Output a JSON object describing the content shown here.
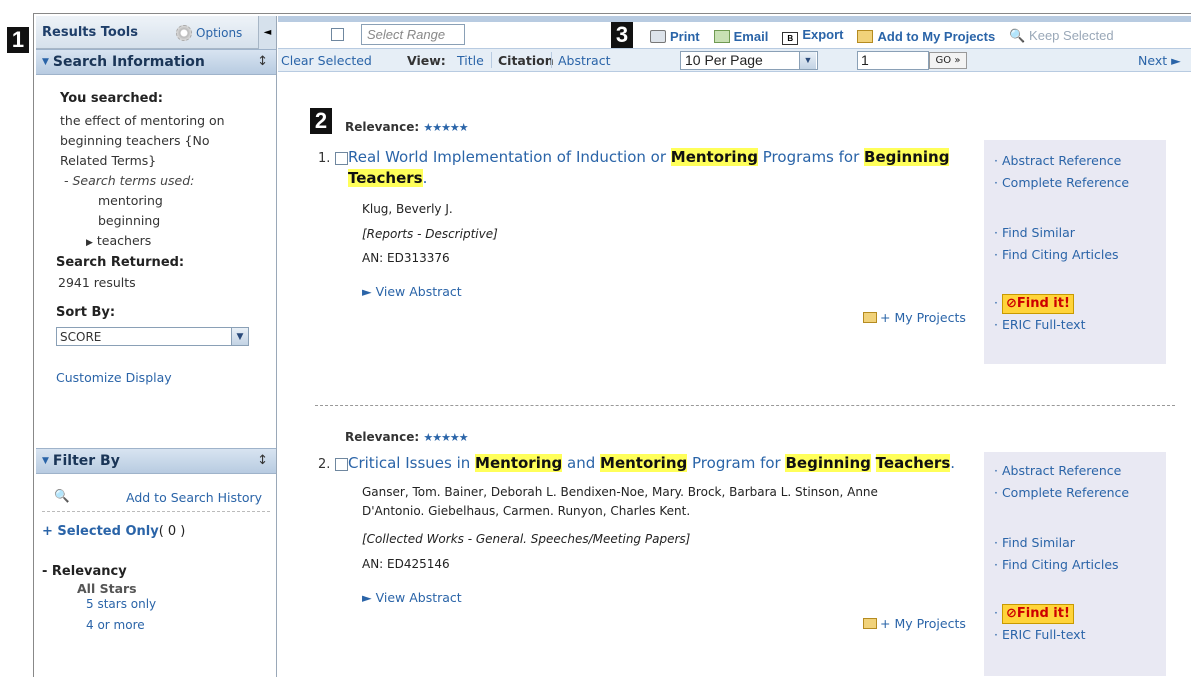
{
  "callouts": [
    "1",
    "2",
    "3"
  ],
  "sidebar": {
    "title": "Results Tools",
    "options_label": "Options",
    "collapse_glyph": "◄",
    "search_info": {
      "heading": "Search Information",
      "you_searched_label": "You searched:",
      "query_lines": [
        "the effect of mentoring on",
        "beginning teachers {No",
        "Related Terms}"
      ],
      "terms_used_label": "- Search terms used:",
      "terms": [
        "mentoring",
        "beginning",
        "teachers"
      ],
      "returned_label": "Search Returned:",
      "returned_value": "2941 results",
      "sort_label": "Sort By:",
      "sort_value": "SCORE",
      "customize": "Customize Display"
    },
    "filter": {
      "heading": "Filter By",
      "add_history": "Add to Search History",
      "selected_only": "+ Selected Only",
      "selected_count": "( 0 )",
      "relevancy_label": "- Relevancy",
      "all_stars": "All Stars",
      "options": [
        "5 stars only",
        "4 or more"
      ]
    }
  },
  "toolbar": {
    "range_placeholder": "Select Range",
    "print": "Print",
    "email": "Email",
    "export": "Export",
    "export_icon_text": "B",
    "add_projects": "Add to My Projects",
    "keep_selected": "Keep Selected"
  },
  "viewbar": {
    "clear": "Clear Selected",
    "view_label": "View:",
    "views": [
      "Title",
      "Citation",
      "Abstract"
    ],
    "per_page": "10 Per Page",
    "page": "1",
    "go": "GO »",
    "next": "Next ►"
  },
  "records": [
    {
      "relevance_label": "Relevance:",
      "stars": "★★★★★",
      "number": "1.",
      "title_parts": [
        {
          "text": "Real World Implementation of Induction or ",
          "hl": false
        },
        {
          "text": "Mentoring",
          "hl": true
        },
        {
          "text": " Programs for ",
          "hl": false
        },
        {
          "text": "Beginning",
          "hl": true
        },
        {
          "text": " ",
          "hl": false
        },
        {
          "text": "Teachers",
          "hl": true
        },
        {
          "text": ".",
          "hl": false
        }
      ],
      "authors": "Klug, Beverly J.",
      "type": "[Reports - Descriptive]",
      "an": "AN: ED313376",
      "view_abstract": "► View Abstract",
      "my_projects": "+ My Projects",
      "links": [
        "Abstract Reference",
        "Complete Reference",
        "Find Similar",
        "Find Citing Articles",
        "ERIC Full-text"
      ],
      "findit": "Find it!"
    },
    {
      "relevance_label": "Relevance:",
      "stars": "★★★★★",
      "number": "2.",
      "title_parts": [
        {
          "text": "Critical Issues in ",
          "hl": false
        },
        {
          "text": "Mentoring",
          "hl": true
        },
        {
          "text": " and ",
          "hl": false
        },
        {
          "text": "Mentoring",
          "hl": true
        },
        {
          "text": " Program for ",
          "hl": false
        },
        {
          "text": "Beginning",
          "hl": true
        },
        {
          "text": " ",
          "hl": false
        },
        {
          "text": "Teachers",
          "hl": true
        },
        {
          "text": ".",
          "hl": false
        }
      ],
      "authors_lines": [
        "Ganser, Tom. Bainer, Deborah L. Bendixen-Noe, Mary. Brock, Barbara L. Stinson, Anne",
        "D'Antonio. Giebelhaus, Carmen. Runyon, Charles Kent."
      ],
      "type": "[Collected Works - General. Speeches/Meeting Papers]",
      "an": "AN: ED425146",
      "view_abstract": "► View Abstract",
      "my_projects": "+ My Projects",
      "links": [
        "Abstract Reference",
        "Complete Reference",
        "Find Similar",
        "Find Citing Articles",
        "ERIC Full-text"
      ],
      "findit": "Find it!"
    }
  ]
}
